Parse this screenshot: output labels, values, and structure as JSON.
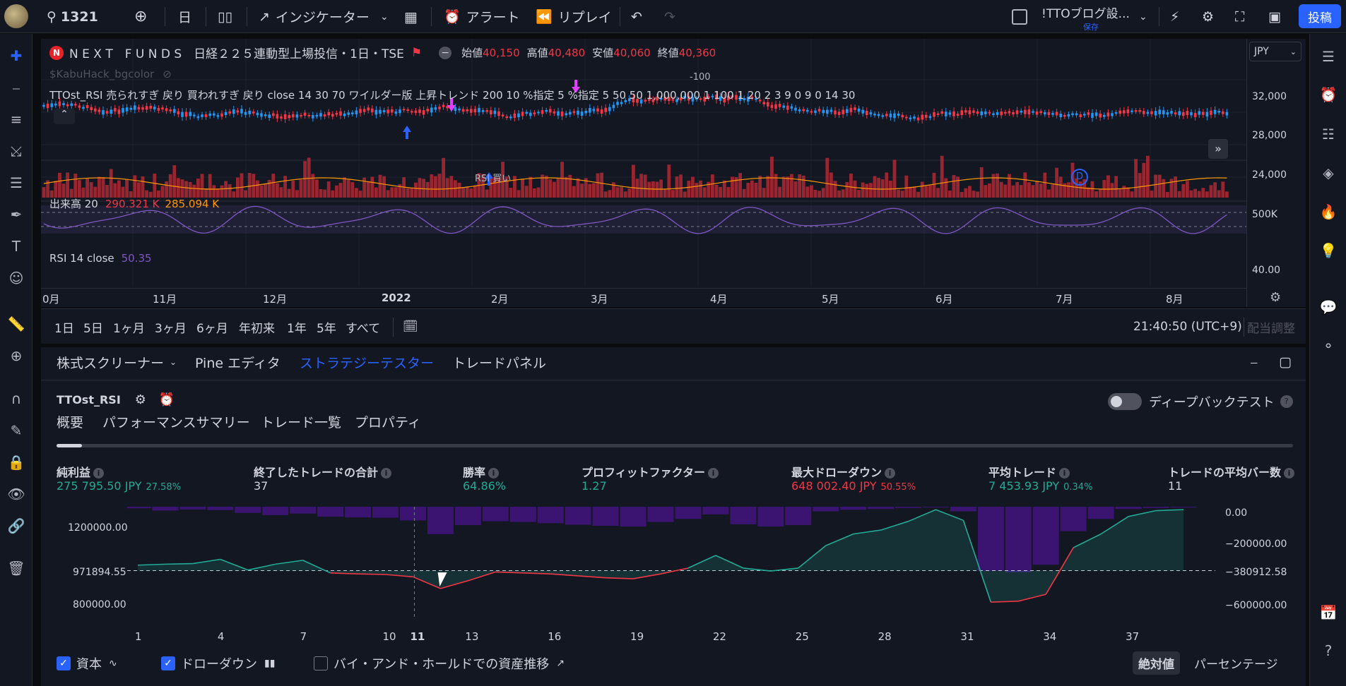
{
  "topbar": {
    "symbol": "1321",
    "interval": "日",
    "indicators": "インジケーター",
    "alert": "アラート",
    "replay": "リプレイ",
    "layout_name": "!TTOブログ設...",
    "layout_saved": "保存",
    "publish": "投稿"
  },
  "chart": {
    "legend_name": "N E X T　F U N D S　日経２２５連動型上場投信・1日・TSE",
    "open_label": "始値",
    "open": "40,150",
    "high_label": "高値",
    "high": "40,480",
    "low_label": "安値",
    "low": "40,060",
    "close_label": "終値",
    "close": "40,360",
    "bgcolor_script": "$KabuHack_bgcolor",
    "strategy_line": "TTOst_RSI 売られすぎ 戻り 買われすぎ 戻り close 14 30 70 ワイルダー版 上昇トレンド 200 10 %指定 5 %指定 5 50 50 1,000,000 1 100 1 20 2 3 9 0 9 0 14 30",
    "volume_legend": "出来高 20",
    "volume_a": "290.321 K",
    "volume_b": "285.094 K",
    "rsi_legend": "RSI 14 close",
    "rsi_value": "50.35",
    "signal_buy": "RSI 買い",
    "signal_minus100": "-100",
    "currency": "JPY",
    "prices": [
      "32,000",
      "28,000",
      "24,000"
    ],
    "vol_scale": "500K",
    "rsi_scale": "40.00",
    "months": [
      "0月",
      "11月",
      "12月",
      "2022",
      "2月",
      "3月",
      "4月",
      "5月",
      "6月",
      "7月",
      "8月"
    ],
    "marker_d": "D"
  },
  "timeframes": {
    "buttons": [
      "1日",
      "5日",
      "1ヶ月",
      "3ヶ月",
      "6ヶ月",
      "年初来",
      "1年",
      "5年",
      "すべて"
    ],
    "clock": "21:40:50 (UTC+9)",
    "adjust": "配当調整"
  },
  "panel": {
    "tabs": [
      "株式スクリーナー",
      "Pine エディタ",
      "ストラテジーテスター",
      "トレードパネル"
    ],
    "strategy_name": "TTOst_RSI",
    "deep_backtest": "ディープバックテスト",
    "subtabs": [
      "概要",
      "パフォーマンスサマリー",
      "トレード一覧",
      "プロパティ"
    ],
    "metrics": [
      {
        "label": "純利益",
        "value": "275 795.50 JPY",
        "sub": "27.58%"
      },
      {
        "label": "終了したトレードの合計",
        "value": "37",
        "sub": ""
      },
      {
        "label": "勝率",
        "value": "64.86%",
        "sub": ""
      },
      {
        "label": "プロフィットファクター",
        "value": "1.27",
        "sub": ""
      },
      {
        "label": "最大ドローダウン",
        "value": "648 002.40 JPY",
        "sub": "50.55%"
      },
      {
        "label": "平均トレード",
        "value": "7 453.93 JPY",
        "sub": "0.34%"
      },
      {
        "label": "トレードの平均バー数",
        "value": "11",
        "sub": ""
      }
    ],
    "y_left": [
      "1200000.00",
      "971894.55",
      "800000.00"
    ],
    "y_right": [
      "0.00",
      "−200000.00",
      "−380912.58",
      "−600000.00"
    ],
    "x_labels": [
      "1",
      "4",
      "7",
      "10",
      "11",
      "13",
      "16",
      "19",
      "22",
      "25",
      "28",
      "31",
      "34",
      "37"
    ],
    "legend_equity": "資本",
    "legend_drawdown": "ドローダウン",
    "legend_buyhold": "バイ・アンド・ホールドでの資産推移",
    "mode_absolute": "絶対値",
    "mode_percent": "パーセンテージ"
  },
  "chart_data": {
    "type": "line",
    "title": "",
    "x": [
      1,
      2,
      3,
      4,
      5,
      6,
      7,
      8,
      9,
      10,
      11,
      12,
      13,
      14,
      15,
      16,
      17,
      18,
      19,
      20,
      21,
      22,
      23,
      24,
      25,
      26,
      27,
      28,
      29,
      30,
      31,
      32,
      33,
      34,
      35,
      36,
      37,
      38,
      39
    ],
    "series": [
      {
        "name": "資本",
        "values": [
          1000000,
          1005000,
          1008000,
          1030000,
          975000,
          1005000,
          1025000,
          960000,
          955000,
          952000,
          940000,
          880000,
          920000,
          965000,
          960000,
          955000,
          945000,
          935000,
          930000,
          955000,
          985000,
          1050000,
          985000,
          970000,
          985000,
          1100000,
          1160000,
          1180000,
          1225000,
          1285000,
          1230000,
          810000,
          815000,
          850000,
          1090000,
          1160000,
          1250000,
          1280000,
          1285000
        ]
      },
      {
        "name": "ドローダウン",
        "values": [
          -10000,
          -25000,
          -18000,
          -22000,
          -40000,
          -55000,
          -45000,
          -65000,
          -70000,
          -72000,
          -90000,
          -180000,
          -120000,
          -95000,
          -100000,
          -108000,
          -118000,
          -125000,
          -130000,
          -100000,
          -80000,
          -50000,
          -115000,
          -130000,
          -120000,
          -30000,
          -20000,
          -15000,
          -8000,
          -4000,
          -30000,
          -420000,
          -430000,
          -380000,
          -160000,
          -80000,
          -15000,
          -8000,
          -5000
        ]
      }
    ],
    "ylim_left": [
      720000,
      1300000
    ],
    "ylim_right": [
      -648000,
      0
    ]
  }
}
